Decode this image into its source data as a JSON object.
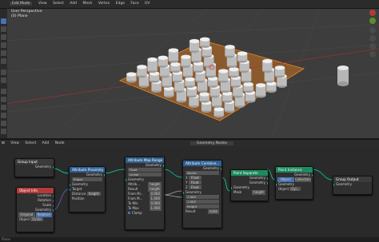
{
  "topbar": {
    "mode": "Edit Mode",
    "menus": [
      "View",
      "Select",
      "Add",
      "Mesh",
      "Vertex",
      "Edge",
      "Face",
      "UV"
    ]
  },
  "viewport": {
    "title_line1": "User Perspective",
    "title_line2": "(0) Plane"
  },
  "node_editor": {
    "header": {
      "menus": [
        "View",
        "Select",
        "Add",
        "Node"
      ],
      "tree_name": "Geometry Nodes"
    },
    "nodes": {
      "group_input": {
        "title": "Group Input",
        "outputs": [
          "Geometry"
        ]
      },
      "object_info": {
        "title": "Object Info",
        "outputs": [
          "Location",
          "Rotation",
          "Scale",
          "Geometry"
        ],
        "toggle": [
          "Original",
          "Relative"
        ],
        "object_label": "Object",
        "object_value": "Circle"
      },
      "attribute_proximity": {
        "title": "Attribute Proximity",
        "output": "Geometry",
        "mode": "Edges",
        "rows": [
          "Geometry",
          "Target"
        ],
        "distance_label": "Distance",
        "distance_value": "height",
        "position_label": "Position"
      },
      "attribute_map_range": {
        "title": "Attribute Map Range",
        "output": "Geometry",
        "type": "Float",
        "interp": "Linear",
        "rows": [
          {
            "label": "Attrib...",
            "value": "height"
          },
          {
            "label": "Result",
            "value": "height"
          },
          {
            "label": "From Mi...",
            "value": "0.000"
          },
          {
            "label": "From M...",
            "value": "1.000"
          },
          {
            "label": "To Min",
            "value": "0.000"
          },
          {
            "label": "To Max",
            "value": "1.000"
          }
        ],
        "clamp_label": "Clamp"
      },
      "attribute_combine": {
        "title": "Attribute Combine...",
        "output": "Geometry",
        "type": "Vector",
        "rows": [
          {
            "label": "X",
            "type": "Float",
            "value": ""
          },
          {
            "label": "Y",
            "type": "Float",
            "value": ""
          },
          {
            "label": "Z",
            "type": "Float",
            "value": ""
          }
        ],
        "geometry_label": "Geometry",
        "values": [
          "1.000",
          "1.000"
        ],
        "z_value": "height",
        "result_label": "Result",
        "result_value": "scale"
      },
      "point_separate": {
        "title": "Point Separate",
        "outputs": [
          "Geometry",
          "Geometry"
        ],
        "inputs": [
          "Geometry",
          "Mask"
        ],
        "mask_value": "height"
      },
      "point_instance": {
        "title": "Point Instance",
        "output": "Geometry",
        "mode_object": "Object",
        "mode_collection": "Collection",
        "geometry_label": "Geometry",
        "object_label": "Object",
        "object_value": "Cyl..."
      },
      "group_output": {
        "title": "Group Output",
        "inputs": [
          "Geometry"
        ]
      }
    },
    "status_label": "Plane"
  },
  "colors": {
    "accent_blue": "#4772b3",
    "geometry_socket": "#00d6a3",
    "vector_socket": "#6363c7",
    "float_socket": "#a1a1a1",
    "header_red": "#b33a3a",
    "header_green": "#1e8a5f",
    "header_blue": "#2f5f8f"
  }
}
